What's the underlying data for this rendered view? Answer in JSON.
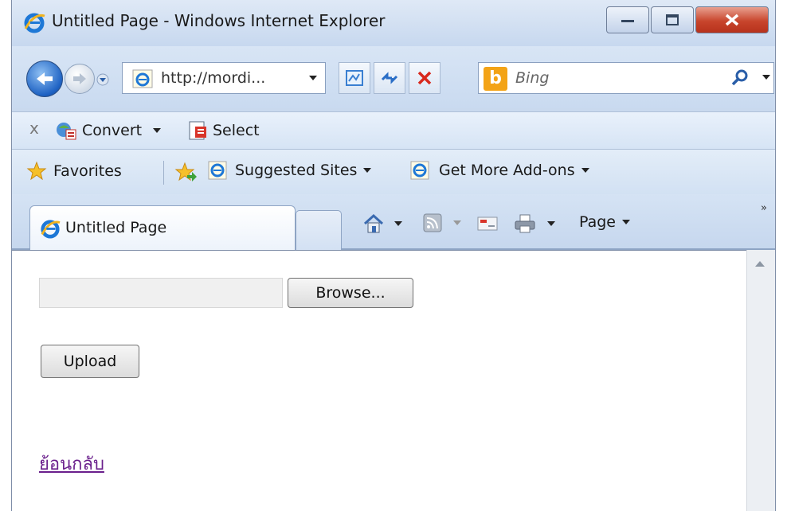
{
  "window": {
    "title": "Untitled Page - Windows Internet Explorer"
  },
  "address_bar": {
    "url": "http://mordi...",
    "search_placeholder": "Bing"
  },
  "command_bar": {
    "convert_label": "Convert",
    "select_label": "Select",
    "close_glyph": "x"
  },
  "favorites_bar": {
    "favorites_label": "Favorites",
    "suggested_sites_label": "Suggested Sites",
    "get_addons_label": "Get More Add-ons"
  },
  "tabs": {
    "active_label": "Untitled Page"
  },
  "toolbar": {
    "page_label": "Page",
    "overflow": "»"
  },
  "page": {
    "browse_label": "Browse...",
    "upload_label": "Upload",
    "back_link": "ย้อนกลับ"
  },
  "colors": {
    "link": "#6a1f8c",
    "close_button": "#c8452c",
    "chrome_bg": "#c9d9ee"
  }
}
